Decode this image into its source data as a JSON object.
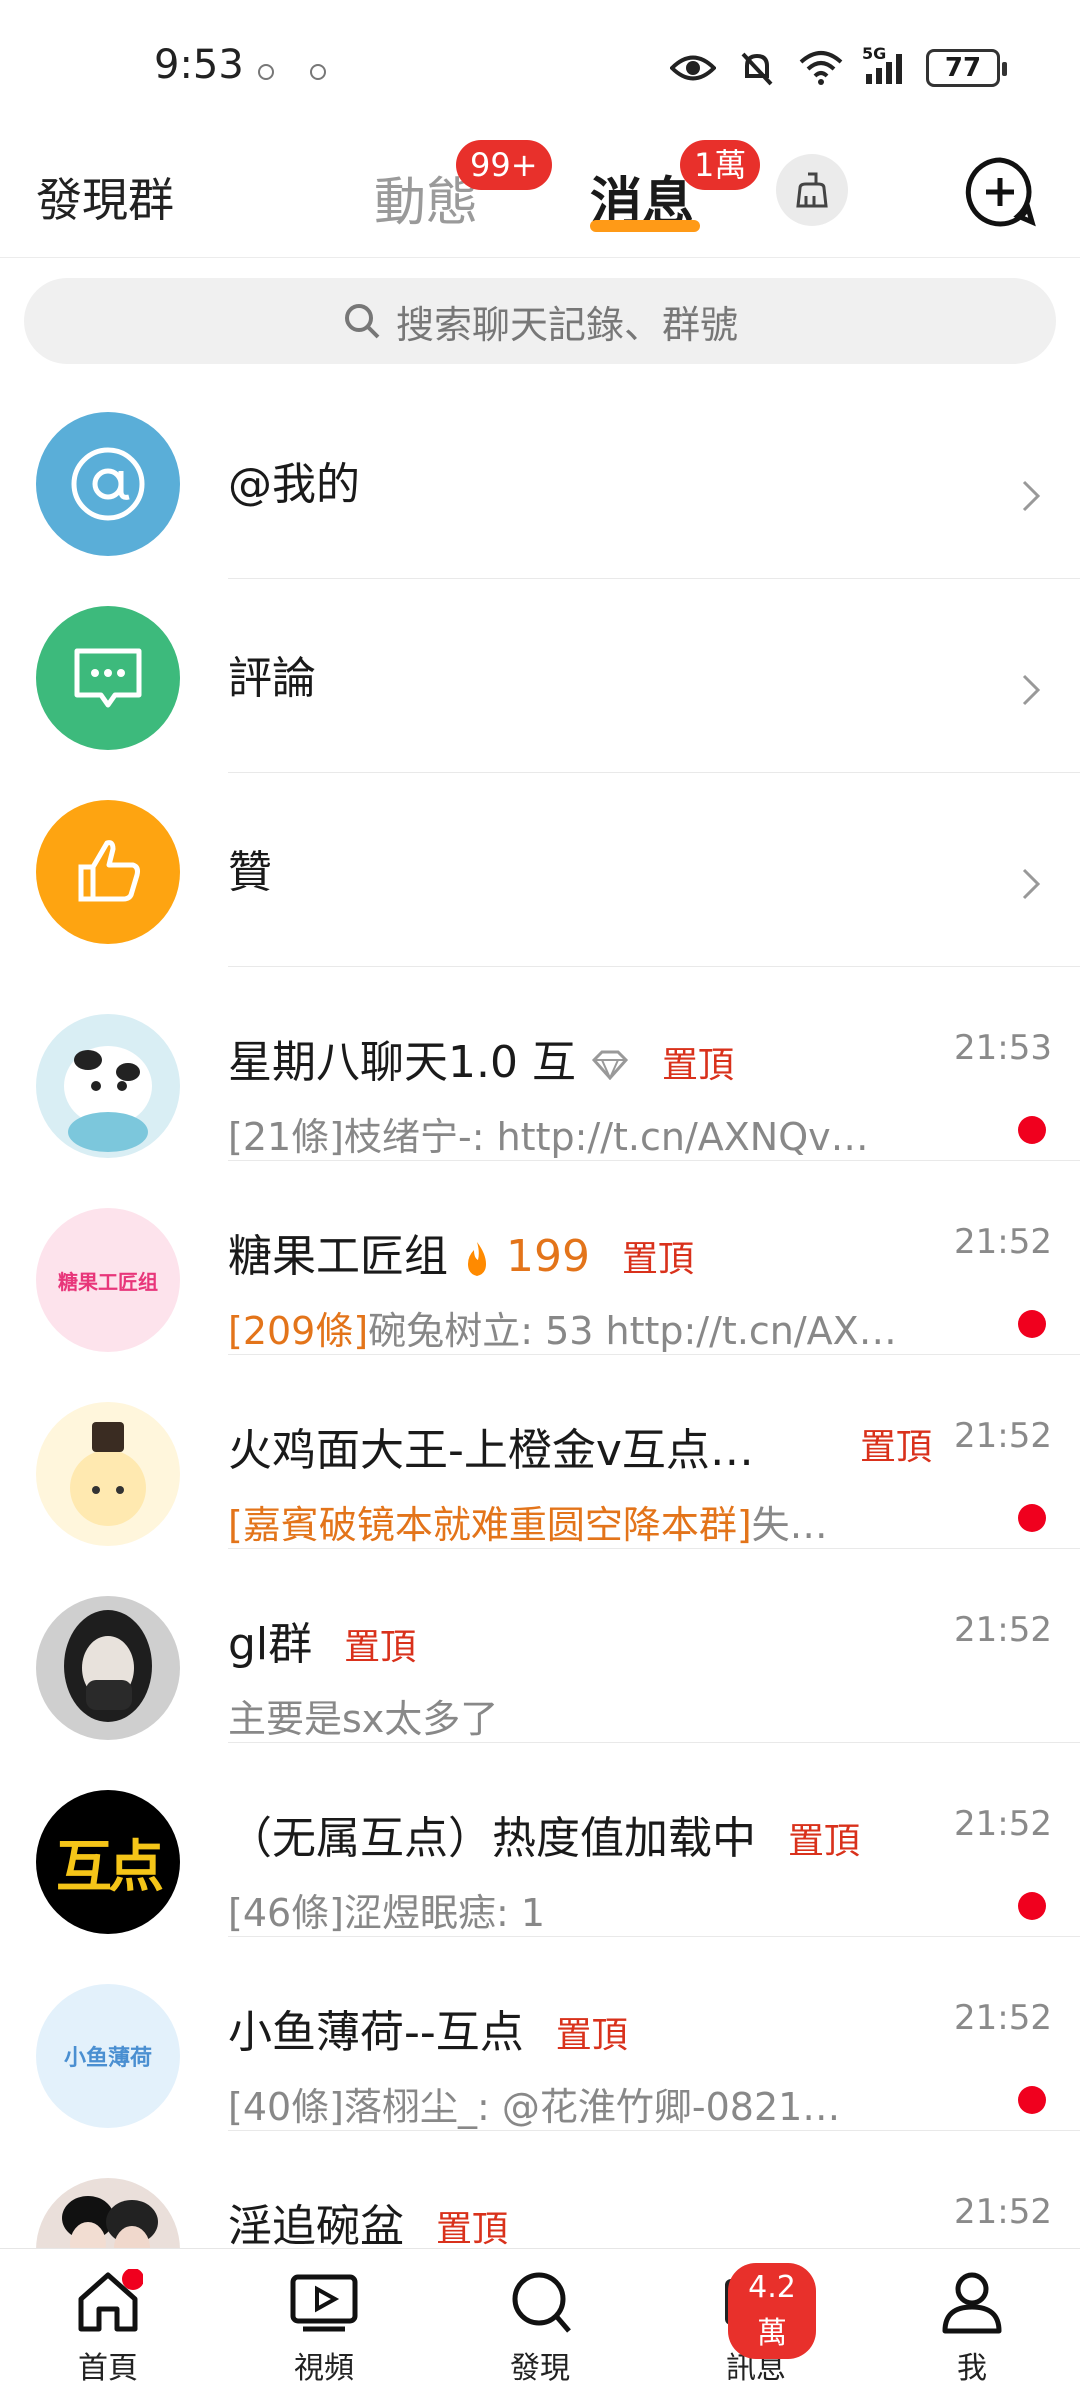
{
  "status": {
    "time": "9:53",
    "battery": "77",
    "network": "5G"
  },
  "topnav": {
    "find_group": "發現群",
    "tabs": [
      {
        "label": "動態",
        "badge": "99+"
      },
      {
        "label": "消息",
        "badge": "1萬"
      }
    ]
  },
  "search": {
    "placeholder": "搜索聊天記錄、群號"
  },
  "shortcuts": [
    {
      "label": "@我的"
    },
    {
      "label": "評論"
    },
    {
      "label": "贊"
    }
  ],
  "chats": [
    {
      "title": "星期八聊天1.0 互",
      "pin": "置頂",
      "time": "21:53",
      "preview": "[21條]枝绪宁-: http://t.cn/AXNQv…",
      "unread": true
    },
    {
      "title": "糖果工匠组",
      "fire_count": "199",
      "pin": "置頂",
      "time": "21:52",
      "preview_highlight": "[209條]",
      "preview": "碗兔树立: 53 http://t.cn/AX…",
      "unread": true
    },
    {
      "title": "火鸡面大王-上橙金v互点…",
      "pin": "置頂",
      "time": "21:52",
      "preview_highlight": "[嘉賓破镜本就难重圆空降本群]",
      "preview": "失…",
      "unread": true
    },
    {
      "title": "gl群",
      "pin": "置頂",
      "time": "21:52",
      "preview": "主要是sx太多了",
      "unread": false
    },
    {
      "title": "（无属互点）热度值加载中",
      "pin": "置頂",
      "time": "21:52",
      "preview": "[46條]涩煜眠痣: 1",
      "unread": true
    },
    {
      "title": "小鱼薄荷--互点",
      "pin": "置頂",
      "time": "21:52",
      "preview": "[40條]落栩尘_: @花淮竹卿-0821…",
      "unread": true
    },
    {
      "title": "淫追碗盆",
      "pin": "置頂",
      "time": "21:52",
      "preview": "",
      "unread": false
    }
  ],
  "avatar_text": {
    "candy": "糖果工匠组",
    "hudian": "互点",
    "mint": "小鱼薄荷"
  },
  "bottomnav": [
    {
      "label": "首頁"
    },
    {
      "label": "視頻"
    },
    {
      "label": "發現"
    },
    {
      "label": "訊息",
      "badge": "4.2萬"
    },
    {
      "label": "我"
    }
  ],
  "colors": {
    "accent": "#ff9a17",
    "badge": "#e8302b",
    "pin": "#d9311b"
  }
}
